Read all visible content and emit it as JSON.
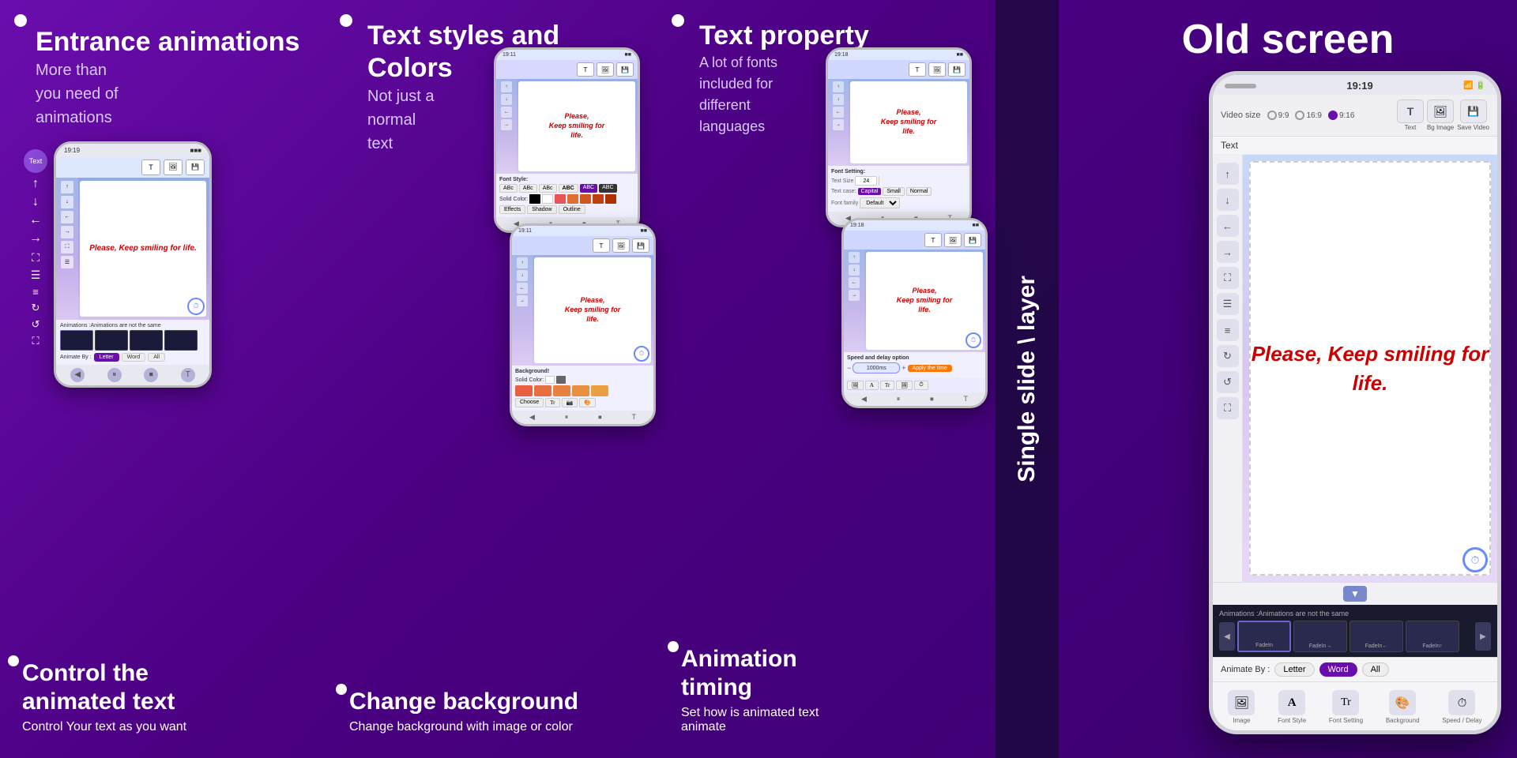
{
  "sections": {
    "entrance": {
      "title": "Entrance animations",
      "subtitle": "More than\nyou need of\nanimations",
      "bottom_title": "Control the\nanimated text",
      "bottom_desc": "Control Your text as you want",
      "phone": {
        "canvas_text": "Please,\nKeep smiling for\nlife.",
        "animations_label": "Animations :Animations are not the same",
        "animate_by": "Animate By :",
        "animate_options": [
          "Letter",
          "Word",
          "All"
        ],
        "active_option": "Letter"
      }
    },
    "text_styles": {
      "title": "Text styles and\nColors",
      "subtitle": "Not just a\nnormal\n text",
      "bottom_title": "Change background",
      "bottom_desc": "Change background with image or color",
      "phone": {
        "canvas_text": "Please,\nKeep smiling for\nlife."
      }
    },
    "text_property": {
      "title": "Text property",
      "subtitle": "A lot of fonts\nincluded for\ndifferent\nlanguages",
      "bottom_title": "Animation\ntiming",
      "bottom_desc": "Set how is animated text\nanimate",
      "phone": {
        "canvas_text": "Please,\nKeep smiling for\nlife.",
        "speed_label": "Speed and delay option"
      }
    },
    "old_screen": {
      "title": "Old screen",
      "single_slide_label": "Single slide \\ layer",
      "phone": {
        "time": "19:19",
        "video_size_label": "Video size",
        "video_sizes": [
          "9:9",
          "16:9",
          "9:16"
        ],
        "active_size": "9:16",
        "canvas_text": "Please,\nKeep smiling for\nlife.",
        "toolbar_labels": [
          "Text",
          "Bg Image",
          "Save Video"
        ],
        "left_tools": [
          "↑",
          "↓",
          "←",
          "→",
          "⛶",
          "☰",
          "↺",
          "↻",
          "⛶"
        ],
        "text_label": "Text",
        "animations_label": "Animations :Animations are not the same",
        "animate_by": "Animate By :",
        "animate_options": [
          "Letter",
          "Word",
          "All"
        ],
        "active_option": "Word",
        "bottom_icons": [
          "🖼",
          "A",
          "Tr",
          "🖼",
          "⏱"
        ]
      }
    }
  },
  "colors": {
    "background_gradient_start": "#6a0dad",
    "background_gradient_end": "#3a006f",
    "accent": "#6a0dad",
    "text_red": "#cc0000",
    "phone_border": "#cccccc",
    "orange": "#ff6600"
  },
  "icons": {
    "dot": "●",
    "arrow_up": "↑",
    "arrow_down": "↓",
    "arrow_left": "←",
    "arrow_right": "→",
    "expand": "⛶",
    "menu": "☰",
    "rotate_cw": "↻",
    "rotate_ccw": "↺",
    "text": "T",
    "image": "🖼",
    "timer": "⏱",
    "play": "▶",
    "pause": "⏸",
    "stop": "⏹"
  }
}
